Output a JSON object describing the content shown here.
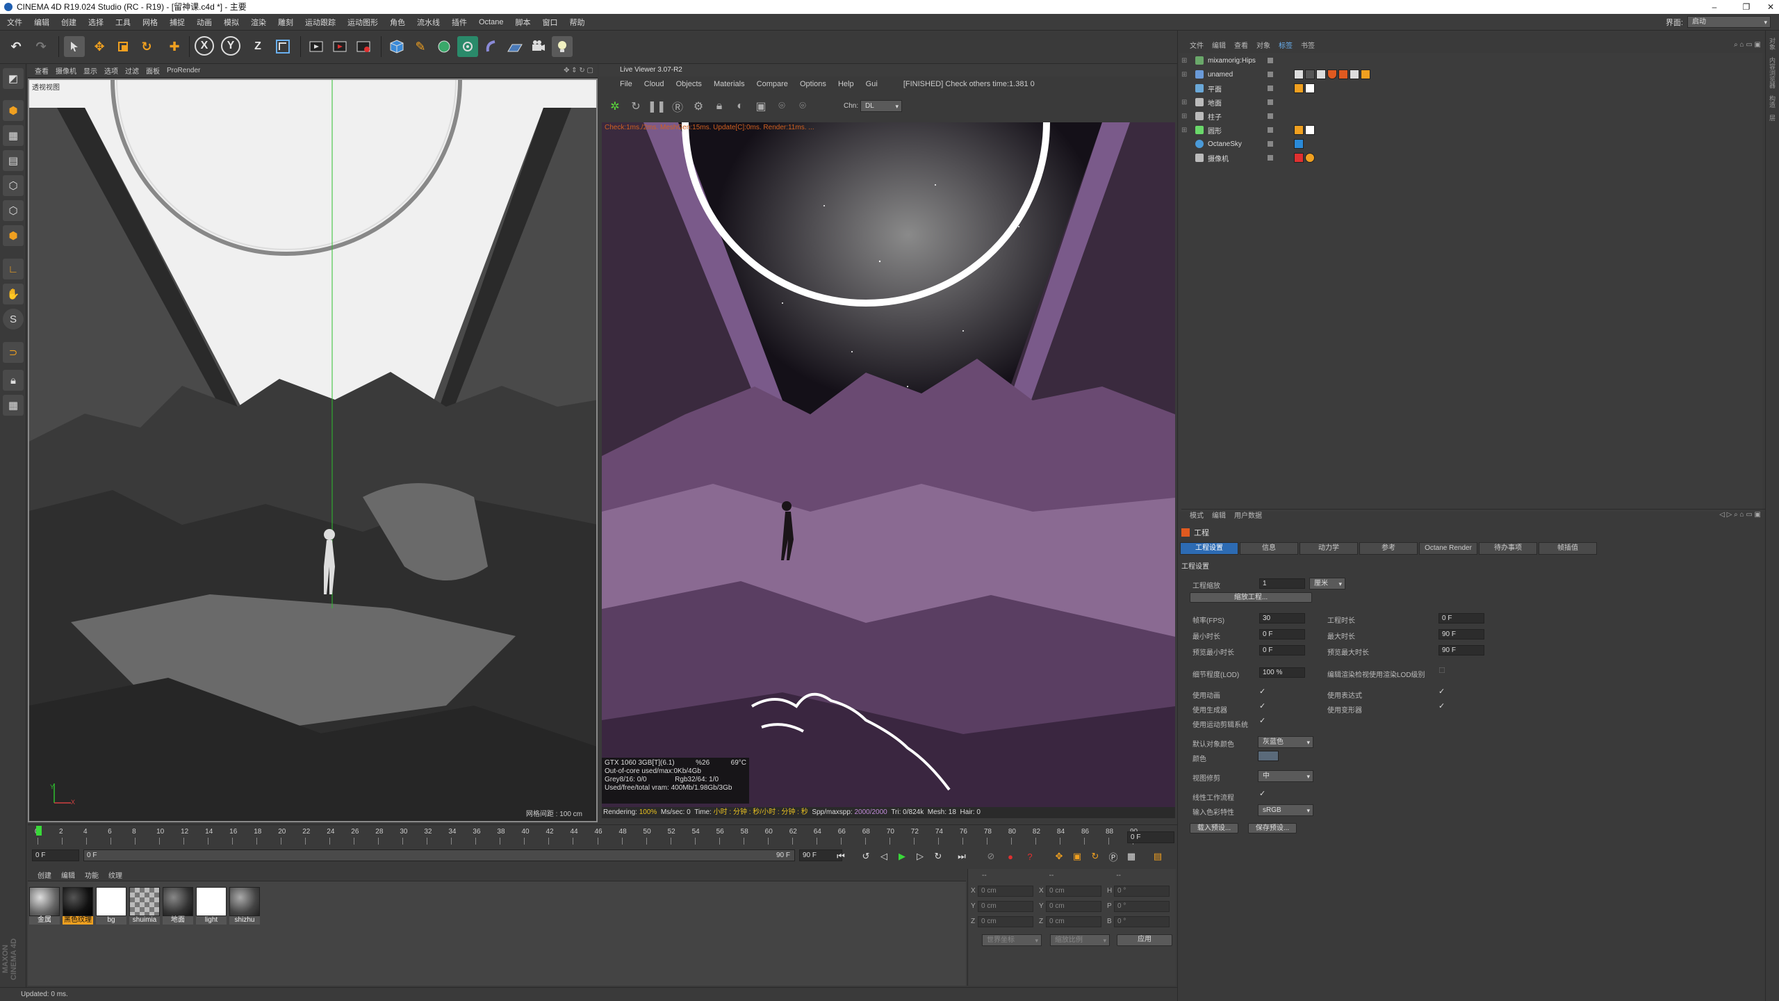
{
  "window": {
    "title": "CINEMA 4D R19.024 Studio (RC - R19) - [留神课.c4d *] - 主要",
    "minimize": "–",
    "restore": "❐",
    "close": "✕"
  },
  "menu": {
    "items": [
      "文件",
      "编辑",
      "创建",
      "选择",
      "工具",
      "网格",
      "捕捉",
      "动画",
      "模拟",
      "渲染",
      "雕刻",
      "运动跟踪",
      "运动图形",
      "角色",
      "流水线",
      "插件",
      "Octane",
      "脚本",
      "窗口",
      "帮助"
    ],
    "layout_label": "界面:",
    "layout_value": "启动"
  },
  "toolbar": {
    "undo": "↶",
    "redo": "↷",
    "x_axis": "X",
    "y_axis": "Y",
    "z_axis": "Z"
  },
  "viewport": {
    "menu": [
      "查看",
      "摄像机",
      "显示",
      "选项",
      "过滤",
      "面板",
      "ProRender"
    ],
    "camera_label": "透视视图",
    "grid_spacing": "网格间距 : 100 cm",
    "axis_x": "X",
    "axis_y": "Y"
  },
  "live_viewer": {
    "title": "Live Viewer 3.07-R2",
    "menu": [
      "File",
      "Cloud",
      "Objects",
      "Materials",
      "Compare",
      "Options",
      "Help",
      "Gui"
    ],
    "status": "[FINISHED] Check others time:1.381  0",
    "channel_label": "Chn:",
    "channel_value": "DL",
    "top_stats": "Check:1ms./2ms.  MeshGen:15ms.  Update[C]:0ms.  Render:11ms.  ..."
  },
  "gpu_stats": {
    "line1a": "GTX 1060 3GB[T](6.1)",
    "line1b": "%26",
    "line1c": "69°C",
    "line2": "Out-of-core used/max:0Kb/4Gb",
    "line3a": "Grey8/16: 0/0",
    "line3b": "Rgb32/64: 1/0",
    "line4": "Used/free/total vram: 400Mb/1.98Gb/3Gb"
  },
  "render_bar": {
    "rendering_label": "Rendering:",
    "rendering_value": "100%",
    "mssec_label": "Ms/sec:",
    "mssec_value": "0",
    "time_label": "Time:",
    "time_value": "小时 : 分钟 : 秒/小时 : 分钟 : 秒",
    "spp_label": "Spp/maxspp:",
    "spp_value": "2000/2000",
    "tri_label": "Tri:",
    "tri_value": "0/824k",
    "mesh_label": "Mesh:",
    "mesh_value": "18",
    "hair_label": "Hair:",
    "hair_value": "0"
  },
  "timeline": {
    "ticks": [
      "0",
      "2",
      "4",
      "6",
      "8",
      "10",
      "12",
      "14",
      "16",
      "18",
      "20",
      "22",
      "24",
      "26",
      "28",
      "30",
      "32",
      "34",
      "36",
      "38",
      "40",
      "42",
      "44",
      "46",
      "48",
      "50",
      "52",
      "54",
      "56",
      "58",
      "60",
      "62",
      "64",
      "66",
      "68",
      "70",
      "72",
      "74",
      "76",
      "78",
      "80",
      "82",
      "84",
      "86",
      "88",
      "90"
    ],
    "current_frame": "0 F",
    "range_start": "0 F",
    "range_end": "90 F",
    "range_end2": "90 F",
    "frame_field": "0 F"
  },
  "materials": {
    "menu": [
      "创建",
      "编辑",
      "功能",
      "纹理"
    ],
    "items": [
      {
        "name": "金属",
        "color": "#8a8a8a"
      },
      {
        "name": "黑色纹理",
        "color": "#1a1a1a",
        "selected": true
      },
      {
        "name": "bg",
        "color": "#ffffff"
      },
      {
        "name": "shuimia",
        "color": "#9a9a9a"
      },
      {
        "name": "地面",
        "color": "#3a3a3a"
      },
      {
        "name": "light",
        "color": "#ffffff"
      },
      {
        "name": "shizhu",
        "color": "#6a6a6a"
      }
    ]
  },
  "coords": {
    "header1": "--",
    "header2": "--",
    "header3": "--",
    "rows": [
      {
        "a": "X",
        "av": "0 cm",
        "b": "X",
        "bv": "0 cm",
        "c": "H",
        "cv": "0 °"
      },
      {
        "a": "Y",
        "av": "0 cm",
        "b": "Y",
        "bv": "0 cm",
        "c": "P",
        "cv": "0 °"
      },
      {
        "a": "Z",
        "av": "0 cm",
        "b": "Z",
        "bv": "0 cm",
        "c": "B",
        "cv": "0 °"
      }
    ],
    "mode1": "世界坐标",
    "mode2": "缩放比例",
    "apply": "应用"
  },
  "status": {
    "text": "Updated: 0 ms."
  },
  "object_manager": {
    "menu": [
      "文件",
      "编辑",
      "查看",
      "对象",
      "标签",
      "书签"
    ],
    "objects": [
      {
        "name": "mixamorig:Hips",
        "color": "#6aa86a"
      },
      {
        "name": "unamed",
        "color": "#6a9ad8"
      },
      {
        "name": "平面",
        "color": "#6aa8d8"
      },
      {
        "name": "地面",
        "color": "#bbbbbb"
      },
      {
        "name": "柱子",
        "color": "#bbbbbb"
      },
      {
        "name": "圆形",
        "color": "#6ad86a"
      },
      {
        "name": "OctaneSky",
        "color": "#4a9ad8"
      },
      {
        "name": "摄像机",
        "color": "#bbbbbb"
      }
    ]
  },
  "attributes": {
    "menu": [
      "模式",
      "编辑",
      "用户数据"
    ],
    "title": "工程",
    "tabs": [
      "工程设置",
      "信息",
      "动力学",
      "参考",
      "Octane Render",
      "待办事项",
      "帧插值"
    ],
    "section": "工程设置",
    "project_scale_label": "工程缩放",
    "project_scale_value": "1",
    "project_scale_unit": "厘米",
    "scale_button": "缩放工程...",
    "fps_label": "帧率(FPS)",
    "fps_value": "30",
    "project_length_label": "工程时长",
    "project_length_value": "0 F",
    "min_time_label": "最小时长",
    "min_time_value": "0 F",
    "max_time_label": "最大时长",
    "max_time_value": "90 F",
    "preview_min_label": "预览最小时长",
    "preview_min_value": "0 F",
    "preview_max_label": "预览最大时长",
    "preview_max_value": "90 F",
    "lod_label": "细节程度(LOD)",
    "lod_value": "100 %",
    "render_lod_label": "编辑渲染检视使用渲染LOD级别",
    "use_anim_label": "使用动画",
    "use_expr_label": "使用表达式",
    "use_gen_label": "使用生成器",
    "use_deform_label": "使用变形器",
    "use_motion_label": "使用运动剪辑系统",
    "default_color_label": "默认对象颜色",
    "default_color_value": "灰蓝色",
    "color_label": "颜色",
    "view_clip_label": "视图修剪",
    "view_clip_value": "中",
    "linear_label": "线性工作流程",
    "input_color_label": "输入色彩特性",
    "input_color_value": "sRGB",
    "load_preset": "载入预设...",
    "save_preset": "保存预设..."
  },
  "side_strip": [
    "对象",
    "内容浏览器",
    "构造",
    "层"
  ]
}
